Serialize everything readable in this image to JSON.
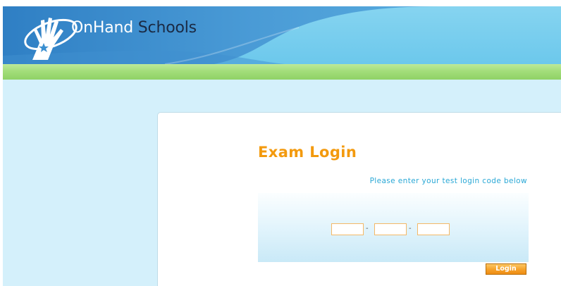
{
  "header": {
    "brand_part1": "OnHand",
    "brand_part2": " Schools",
    "logo_icon": "onhand-hand-star-icon"
  },
  "login": {
    "title": "Exam Login",
    "instruction": "Please enter your test login code below",
    "code_fields": [
      {
        "value": "",
        "placeholder": ""
      },
      {
        "value": "",
        "placeholder": ""
      },
      {
        "value": "",
        "placeholder": ""
      }
    ],
    "separator": "-",
    "button_label": "Login"
  },
  "colors": {
    "header_blue": "#3b8fd0",
    "header_light_blue": "#7fd0ee",
    "green_bar": "#a3de7a",
    "background": "#d4f0fb",
    "title_orange": "#f39a0e",
    "instruction_blue": "#2aa8d6",
    "button_orange": "#f5a12a"
  }
}
